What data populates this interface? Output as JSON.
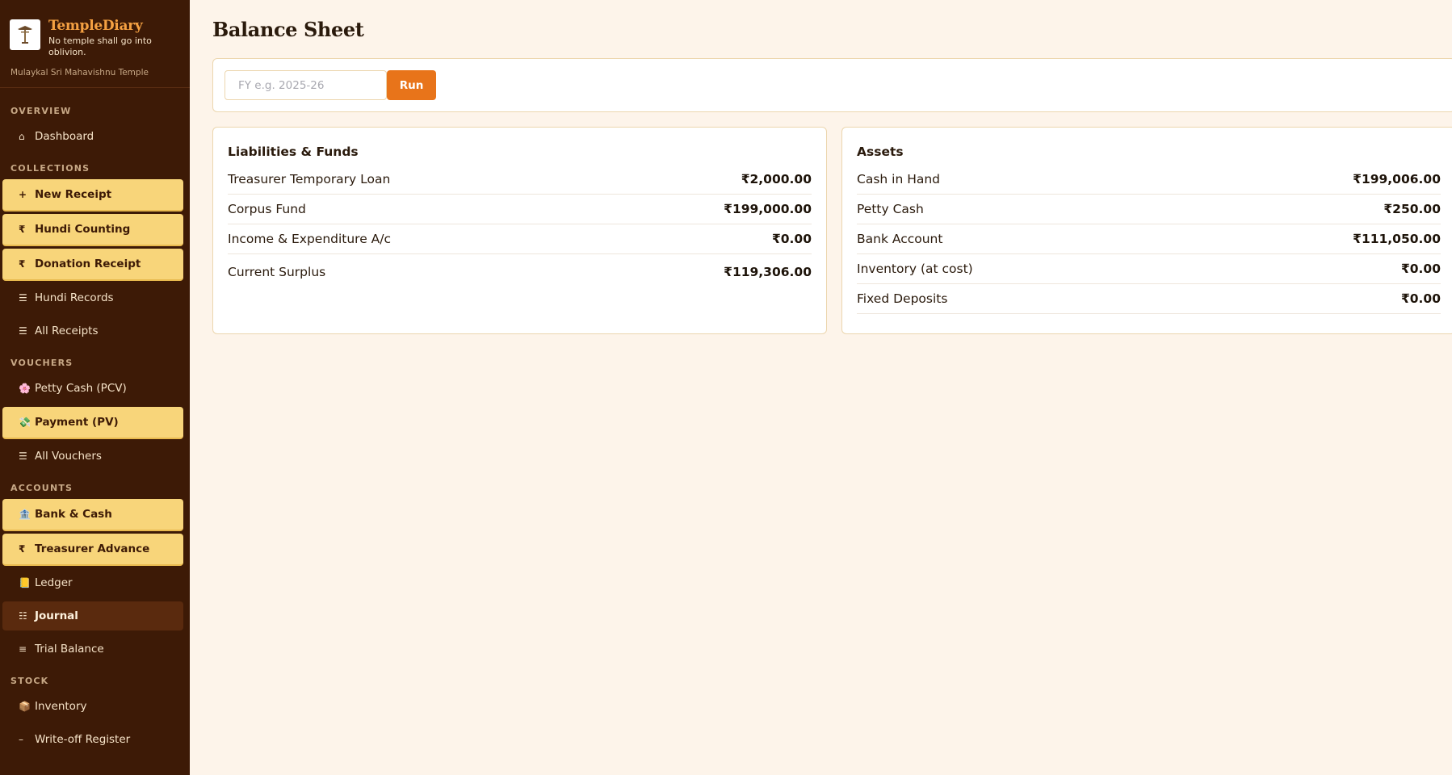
{
  "brand": {
    "title": "TempleDiary",
    "tagline": "No temple shall go into oblivion.",
    "temple_name": "Mulaykal Sri Mahavishnu Temple"
  },
  "sidebar": {
    "sections": [
      {
        "label": "OVERVIEW",
        "items": [
          {
            "label": "Dashboard",
            "icon": "⌂",
            "style": "plain"
          }
        ]
      },
      {
        "label": "COLLECTIONS",
        "items": [
          {
            "label": "New Receipt",
            "icon": "+",
            "style": "hl"
          },
          {
            "label": "Hundi Counting",
            "icon": "₹",
            "style": "hl"
          },
          {
            "label": "Donation Receipt",
            "icon": "₹",
            "style": "hl"
          },
          {
            "label": "Hundi Records",
            "icon": "☰",
            "style": "plain"
          },
          {
            "label": "All Receipts",
            "icon": "☰",
            "style": "plain"
          }
        ]
      },
      {
        "label": "VOUCHERS",
        "items": [
          {
            "label": "Petty Cash (PCV)",
            "icon": "🌸",
            "style": "plain"
          },
          {
            "label": "Payment (PV)",
            "icon": "💸",
            "style": "hl"
          },
          {
            "label": "All Vouchers",
            "icon": "☰",
            "style": "plain"
          }
        ]
      },
      {
        "label": "ACCOUNTS",
        "items": [
          {
            "label": "Bank & Cash",
            "icon": "🏦",
            "style": "hl"
          },
          {
            "label": "Treasurer Advance",
            "icon": "₹",
            "style": "hl"
          },
          {
            "label": "Ledger",
            "icon": "📒",
            "style": "plain"
          },
          {
            "label": "Journal",
            "icon": "☷",
            "style": "active"
          },
          {
            "label": "Trial Balance",
            "icon": "≡",
            "style": "plain"
          }
        ]
      },
      {
        "label": "STOCK",
        "items": [
          {
            "label": "Inventory",
            "icon": "📦",
            "style": "plain"
          },
          {
            "label": "Write-off Register",
            "icon": "–",
            "style": "plain"
          }
        ]
      }
    ]
  },
  "page": {
    "title": "Balance Sheet",
    "fy_input": {
      "value": "",
      "placeholder": "FY e.g. 2025-26"
    },
    "run_label": "Run"
  },
  "liabilities": {
    "title": "Liabilities & Funds",
    "rows": [
      {
        "label": "Treasurer Temporary Loan",
        "amount": "₹2,000.00"
      },
      {
        "label": "Corpus Fund",
        "amount": "₹199,000.00"
      },
      {
        "label": "Income & Expenditure A/c",
        "amount": "₹0.00"
      }
    ],
    "surplus": {
      "label": "Current Surplus",
      "amount": "₹119,306.00"
    }
  },
  "assets": {
    "title": "Assets",
    "rows": [
      {
        "label": "Cash in Hand",
        "amount": "₹199,006.00"
      },
      {
        "label": "Petty Cash",
        "amount": "₹250.00"
      },
      {
        "label": "Bank Account",
        "amount": "₹111,050.00"
      },
      {
        "label": "Inventory (at cost)",
        "amount": "₹0.00"
      },
      {
        "label": "Fixed Deposits",
        "amount": "₹0.00"
      }
    ]
  }
}
